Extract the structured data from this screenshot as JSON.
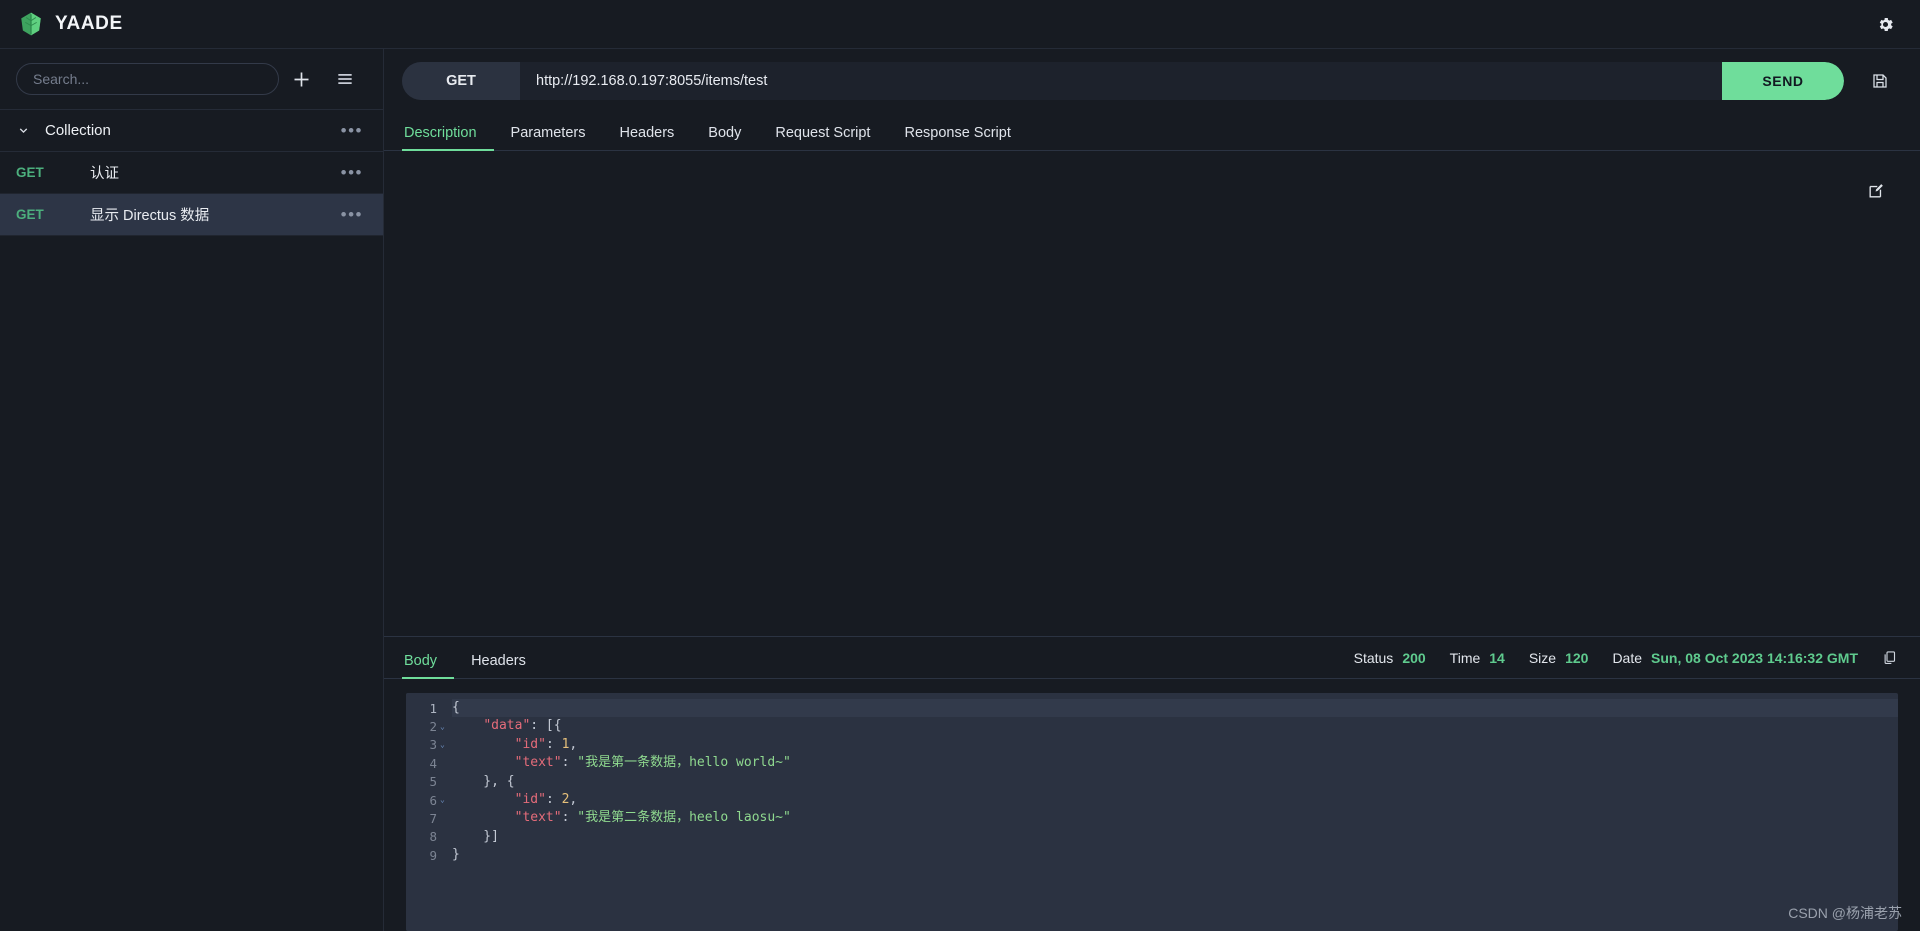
{
  "app": {
    "title": "YAADE",
    "logo_icon": "yaade-leaf-logo",
    "settings_icon": "gear-icon"
  },
  "sidebar": {
    "search": {
      "placeholder": "Search...",
      "value": ""
    },
    "add_icon": "plus-icon",
    "menu_icon": "hamburger-icon",
    "collection": {
      "name": "Collection",
      "expanded": true,
      "chevron_icon": "chevron-down-icon",
      "more_icon": "ellipsis-icon"
    },
    "requests": [
      {
        "method": "GET",
        "name": "认证",
        "selected": false,
        "more_icon": "ellipsis-icon"
      },
      {
        "method": "GET",
        "name": "显示 Directus 数据",
        "selected": true,
        "more_icon": "ellipsis-icon"
      }
    ]
  },
  "request": {
    "method": "GET",
    "url": "http://192.168.0.197:8055/items/test",
    "send_label": "SEND",
    "save_icon": "floppy-save-icon",
    "tabs": [
      {
        "label": "Description",
        "active": true
      },
      {
        "label": "Parameters",
        "active": false
      },
      {
        "label": "Headers",
        "active": false
      },
      {
        "label": "Body",
        "active": false
      },
      {
        "label": "Request Script",
        "active": false
      },
      {
        "label": "Response Script",
        "active": false
      }
    ],
    "description_body": "",
    "edit_icon": "edit-pencil-icon"
  },
  "response": {
    "tabs": [
      {
        "label": "Body",
        "active": true
      },
      {
        "label": "Headers",
        "active": false
      }
    ],
    "status": {
      "status_label": "Status",
      "status_value": "200",
      "time_label": "Time",
      "time_value": "14",
      "size_label": "Size",
      "size_value": "120",
      "date_label": "Date",
      "date_value": "Sun, 08 Oct 2023 14:16:32 GMT"
    },
    "copy_icon": "copy-icon",
    "code": {
      "lines": [
        {
          "n": "1",
          "fold": false,
          "text": "{"
        },
        {
          "n": "2",
          "fold": true,
          "text": "    \"data\": [{"
        },
        {
          "n": "3",
          "fold": true,
          "text": "        \"id\": 1,"
        },
        {
          "n": "4",
          "fold": false,
          "text": "        \"text\": \"我是第一条数据，hello world~\""
        },
        {
          "n": "5",
          "fold": false,
          "text": "    }, {"
        },
        {
          "n": "6",
          "fold": true,
          "text": "        \"id\": 2,"
        },
        {
          "n": "7",
          "fold": false,
          "text": "        \"text\": \"我是第二条数据，heelo laosu~\""
        },
        {
          "n": "8",
          "fold": false,
          "text": "    }]"
        },
        {
          "n": "9",
          "fold": false,
          "text": "}"
        }
      ]
    }
  },
  "watermark": {
    "text": "CSDN @杨浦老苏"
  },
  "colors": {
    "accent_green": "#6fdd9b",
    "method_green": "#4caf7d",
    "background": "#171b22",
    "panel": "#2b3241",
    "selected_row": "#2d3546"
  }
}
